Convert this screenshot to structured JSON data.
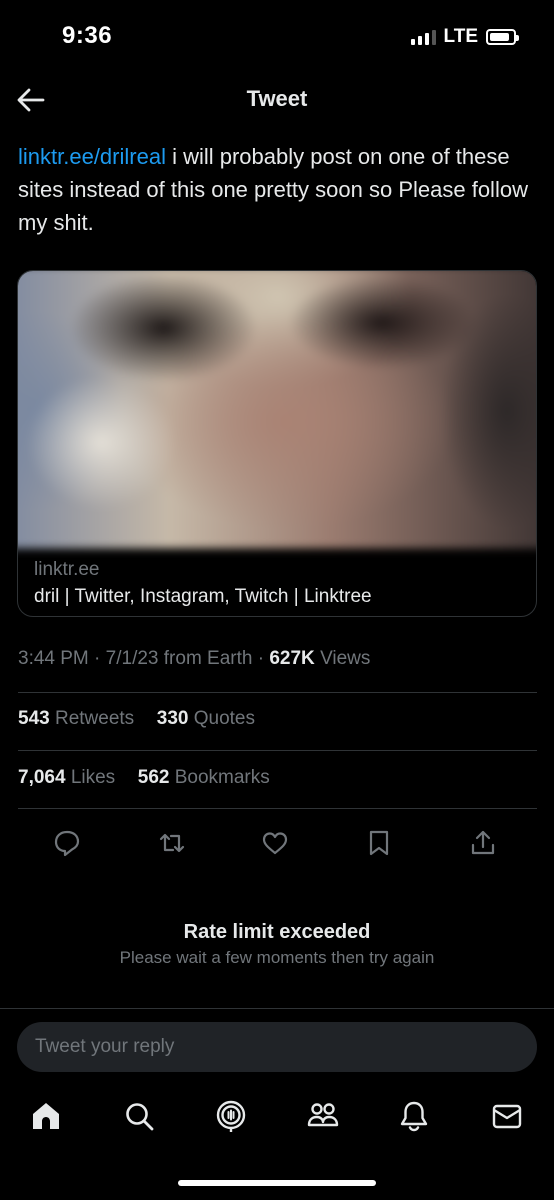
{
  "status_bar": {
    "time": "9:36",
    "network": "LTE",
    "signal_bars_filled": 3,
    "signal_bars_total": 4,
    "battery_level": 0.85
  },
  "header": {
    "title": "Tweet",
    "back_icon": "arrow-left-icon"
  },
  "tweet": {
    "link_text": "linktr.ee/drilreal",
    "body_text": " i will probably post on one of these sites instead of this one pretty soon so Please follow my shit."
  },
  "card": {
    "domain": "linktr.ee",
    "title": "dril | Twitter, Instagram, Twitch | Linktree"
  },
  "meta": {
    "time": "3:44 PM",
    "date": "7/1/23",
    "source": "from Earth",
    "views_count": "627K",
    "views_label": "Views",
    "separator": "·"
  },
  "stats": {
    "retweets_count": "543",
    "retweets_label": "Retweets",
    "quotes_count": "330",
    "quotes_label": "Quotes",
    "likes_count": "7,064",
    "likes_label": "Likes",
    "bookmarks_count": "562",
    "bookmarks_label": "Bookmarks"
  },
  "actions": [
    "reply-icon",
    "retweet-icon",
    "like-icon",
    "bookmark-icon",
    "share-icon"
  ],
  "rate_limit": {
    "title": "Rate limit exceeded",
    "subtitle": "Please wait a few moments then try again"
  },
  "reply": {
    "placeholder": "Tweet your reply"
  },
  "bottom_nav": [
    "home-icon",
    "search-icon",
    "spaces-icon",
    "communities-icon",
    "notifications-icon",
    "messages-icon"
  ],
  "colors": {
    "background": "#000000",
    "text_primary": "#e7e9ea",
    "text_secondary": "#71767b",
    "link": "#1d9bf0",
    "divider": "#2f3336",
    "input_bg": "#202327"
  }
}
